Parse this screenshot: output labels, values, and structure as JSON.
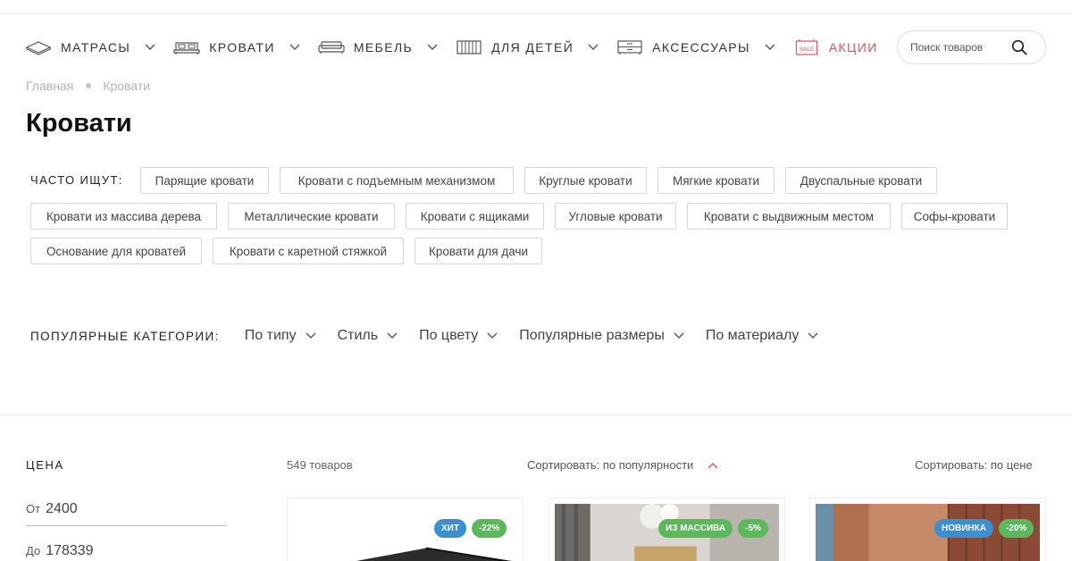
{
  "nav": [
    {
      "label": "МАТРАСЫ",
      "icon": "mattress-icon"
    },
    {
      "label": "КРОВАТИ",
      "icon": "bed-icon"
    },
    {
      "label": "МЕБЕЛЬ",
      "icon": "sofa-icon"
    },
    {
      "label": "ДЛЯ ДЕТЕЙ",
      "icon": "crib-icon"
    },
    {
      "label": "АКСЕССУАРЫ",
      "icon": "drawer-icon"
    },
    {
      "label": "АКЦИИ",
      "icon": "sale-tag-icon",
      "badge_text": "SALE"
    }
  ],
  "search": {
    "placeholder": "Поиск товаров"
  },
  "breadcrumb": [
    "Главная",
    "Кровати"
  ],
  "page_title": "Кровати",
  "frequent": {
    "label": "ЧАСТО ИЩУТ:",
    "tags": [
      "Парящие кровати",
      "Кровати с подъемным механизмом",
      "Круглые кровати",
      "Мягкие кровати",
      "Двуспальные кровати",
      "Кровати из массива дерева",
      "Металлические кровати",
      "Кровати с ящиками",
      "Угловые кровати",
      "Кровати с выдвижным местом",
      "Софы-кровати",
      "Основание для кроватей",
      "Кровати с каретной стяжкой",
      "Кровати для дачи"
    ]
  },
  "popular": {
    "label": "ПОПУЛЯРНЫЕ КАТЕГОРИИ:",
    "items": [
      "По типу",
      "Стиль",
      "По цвету",
      "Популярные размеры",
      "По материалу"
    ]
  },
  "filters": {
    "price_title": "ЦЕНА",
    "from_label": "От",
    "from_value": "2400",
    "to_label": "До",
    "to_value": "178339"
  },
  "listing": {
    "count": "549 товаров",
    "sort_popularity": "Сортировать: по популярности",
    "sort_price": "Сортировать: по цене"
  },
  "cards": [
    {
      "badges": [
        {
          "text": "ХИТ",
          "color": "#3b8fd1"
        },
        {
          "text": "-22%",
          "color": "#5cb85c"
        }
      ]
    },
    {
      "badges": [
        {
          "text": "ИЗ МАССИВА",
          "color": "#5cb85c"
        },
        {
          "text": "-5%",
          "color": "#5cb85c"
        }
      ]
    },
    {
      "badges": [
        {
          "text": "НОВИНКА",
          "color": "#3b8fd1"
        },
        {
          "text": "-20%",
          "color": "#5cb85c"
        }
      ]
    }
  ],
  "colors": {
    "accent_sale": "#e0525f",
    "badge_blue": "#3b8fd1",
    "badge_green": "#5cb85c"
  }
}
